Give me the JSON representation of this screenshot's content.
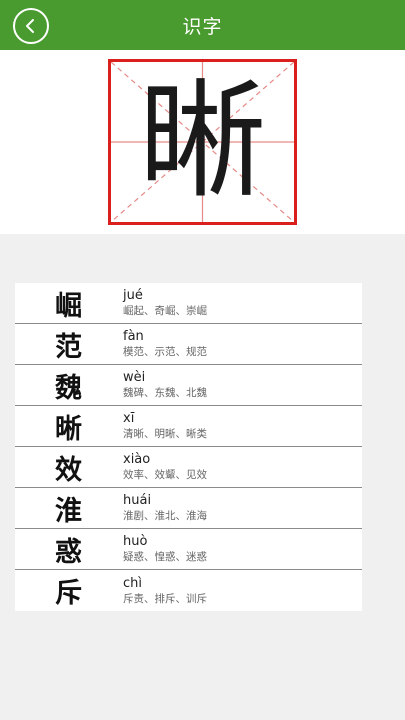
{
  "header": {
    "title": "识字",
    "back_icon": "back-arrow-icon",
    "bg_color": "#4a9b2f"
  },
  "main_character": {
    "char": "晰",
    "grid_color": "#d9201c"
  },
  "list": [
    {
      "char": "崛",
      "pinyin": "jué",
      "words": "崛起、奇崛、崇崛"
    },
    {
      "char": "范",
      "pinyin": "fàn",
      "words": "模范、示范、规范"
    },
    {
      "char": "魏",
      "pinyin": "wèi",
      "words": "魏碑、东魏、北魏"
    },
    {
      "char": "晰",
      "pinyin": "xī",
      "words": "清晰、明晰、晰类"
    },
    {
      "char": "效",
      "pinyin": "xiào",
      "words": "效率、效颦、见效"
    },
    {
      "char": "淮",
      "pinyin": "huái",
      "words": "淮剧、淮北、淮海"
    },
    {
      "char": "惑",
      "pinyin": "huò",
      "words": "疑惑、惶惑、迷惑"
    },
    {
      "char": "斥",
      "pinyin": "chì",
      "words": "斥责、排斥、训斥"
    }
  ]
}
